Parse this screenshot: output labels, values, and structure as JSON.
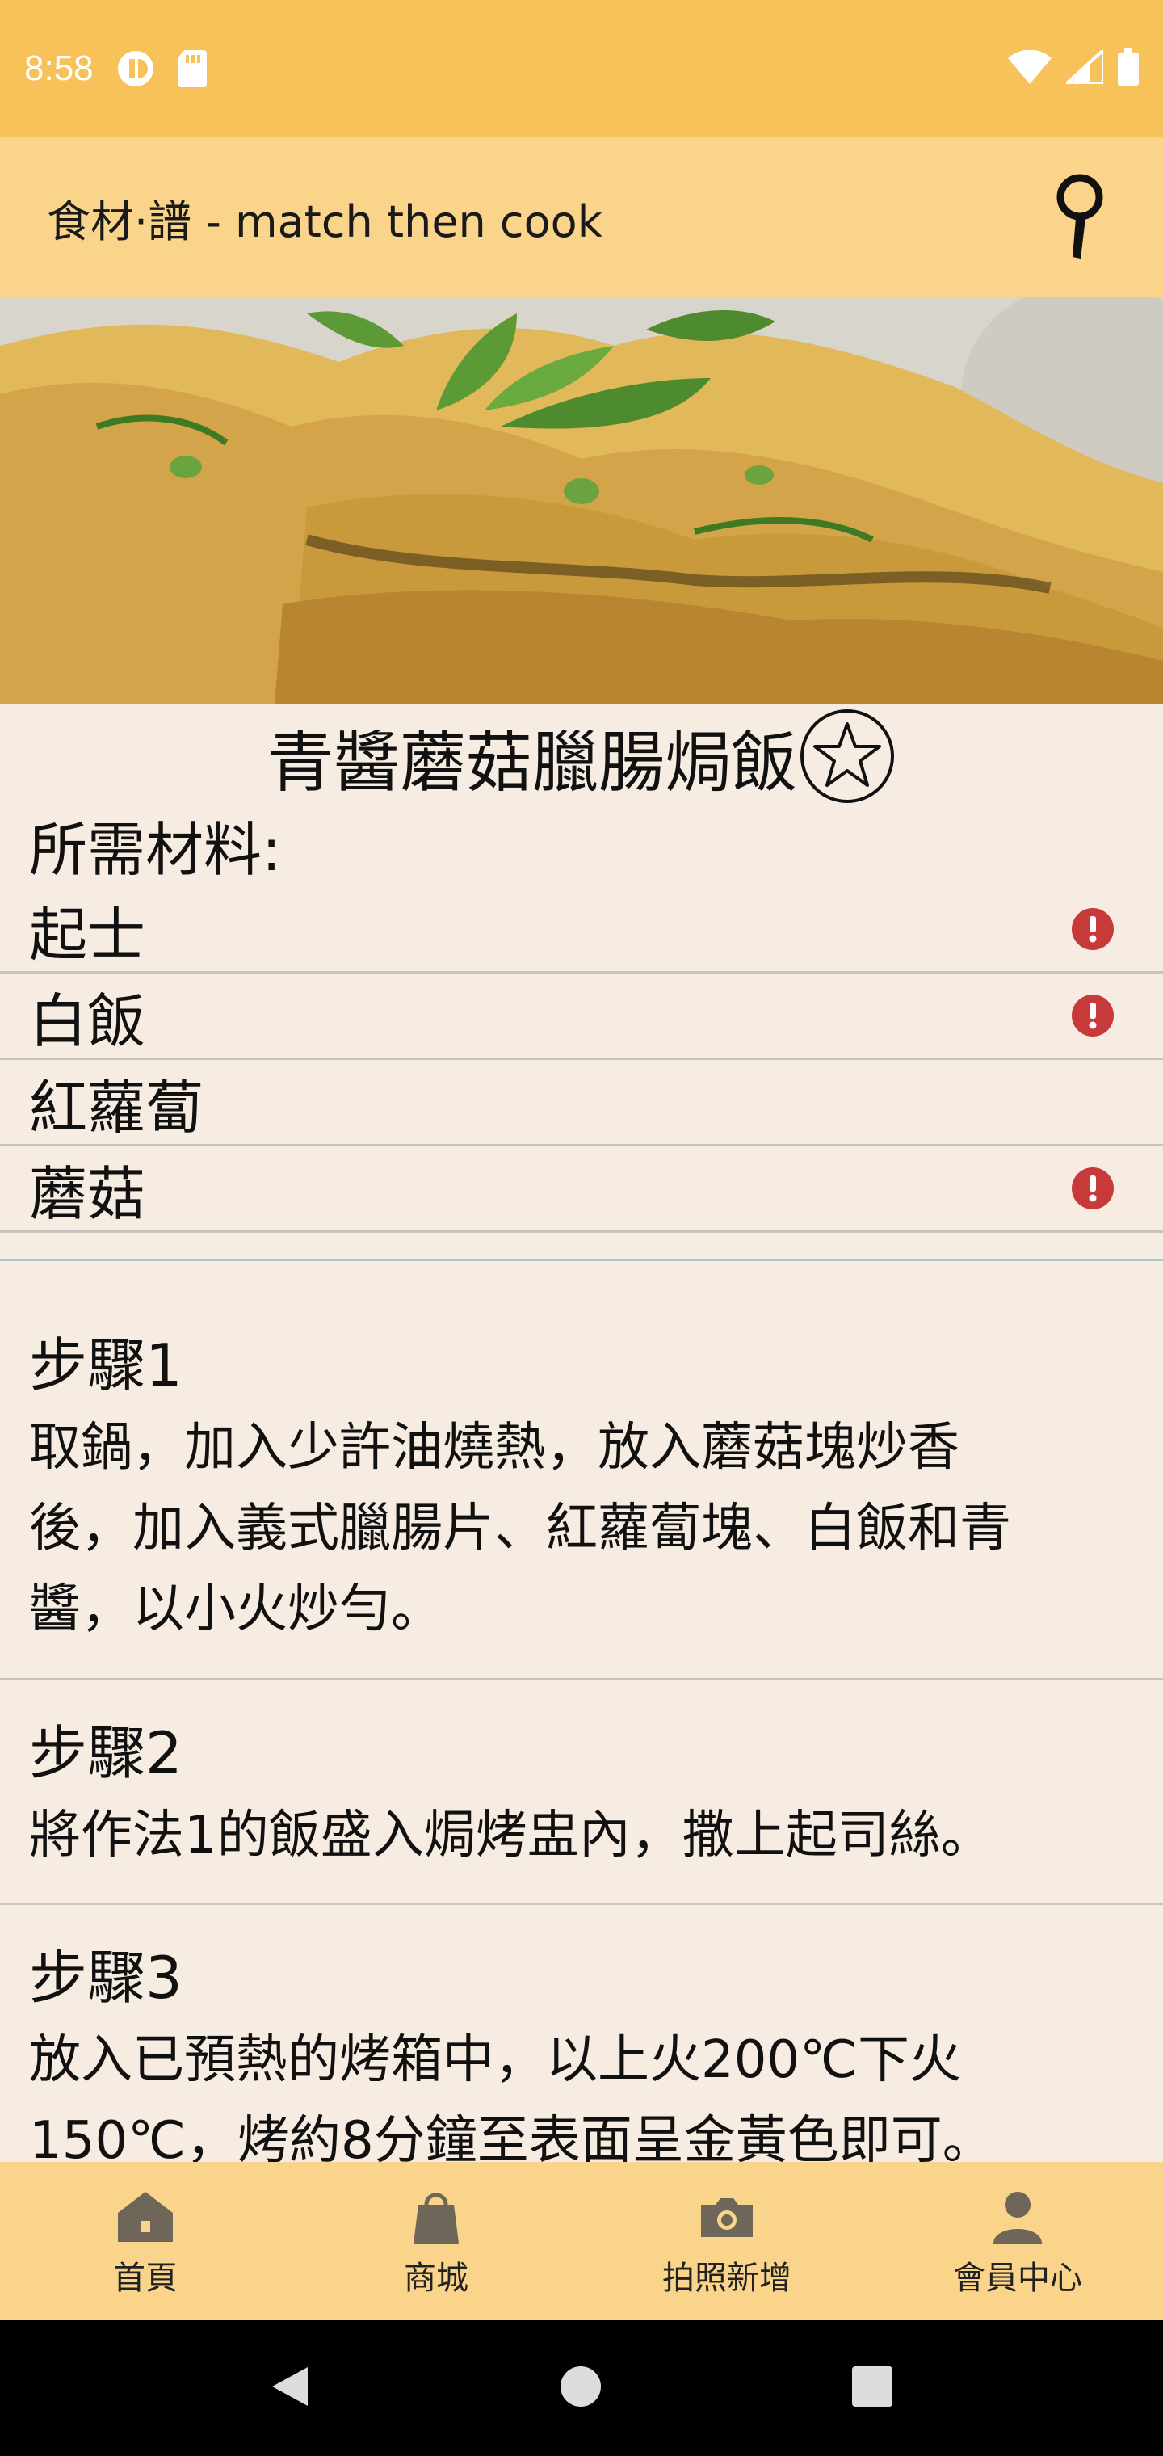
{
  "status_bar": {
    "time": "8:58"
  },
  "app_bar": {
    "title": "食材·譜 - match then cook"
  },
  "recipe": {
    "title": "青醬蘑菇臘腸焗飯",
    "ingredients_heading": "所需材料:",
    "ingredients": [
      {
        "name": "起士",
        "alert": true
      },
      {
        "name": "白飯",
        "alert": true
      },
      {
        "name": "紅蘿蔔",
        "alert": false
      },
      {
        "name": "蘑菇",
        "alert": true
      }
    ],
    "steps": [
      {
        "title": "步驟1",
        "lines": [
          "取鍋，加入少許油燒熱，放入蘑菇塊炒香",
          "後，加入義式臘腸片、紅蘿蔔塊、白飯和青",
          "醬，以小火炒勻。"
        ]
      },
      {
        "title": "步驟2",
        "lines": [
          "將作法1的飯盛入焗烤盅內，撒上起司絲。"
        ]
      },
      {
        "title": "步驟3",
        "lines": [
          "放入已預熱的烤箱中，以上火200℃下火",
          "150℃，烤約8分鐘至表面呈金黃色即可。"
        ]
      }
    ]
  },
  "bottom_nav": {
    "items": [
      {
        "label": "首頁",
        "icon": "house-icon"
      },
      {
        "label": "商城",
        "icon": "shopping-bag-icon"
      },
      {
        "label": "拍照新增",
        "icon": "camera-icon"
      },
      {
        "label": "會員中心",
        "icon": "person-icon"
      }
    ]
  },
  "colors": {
    "status_bar": "#f7c25a",
    "app_bar": "#f9d48a",
    "background": "#f6ece2",
    "alert": "#c8393a"
  }
}
